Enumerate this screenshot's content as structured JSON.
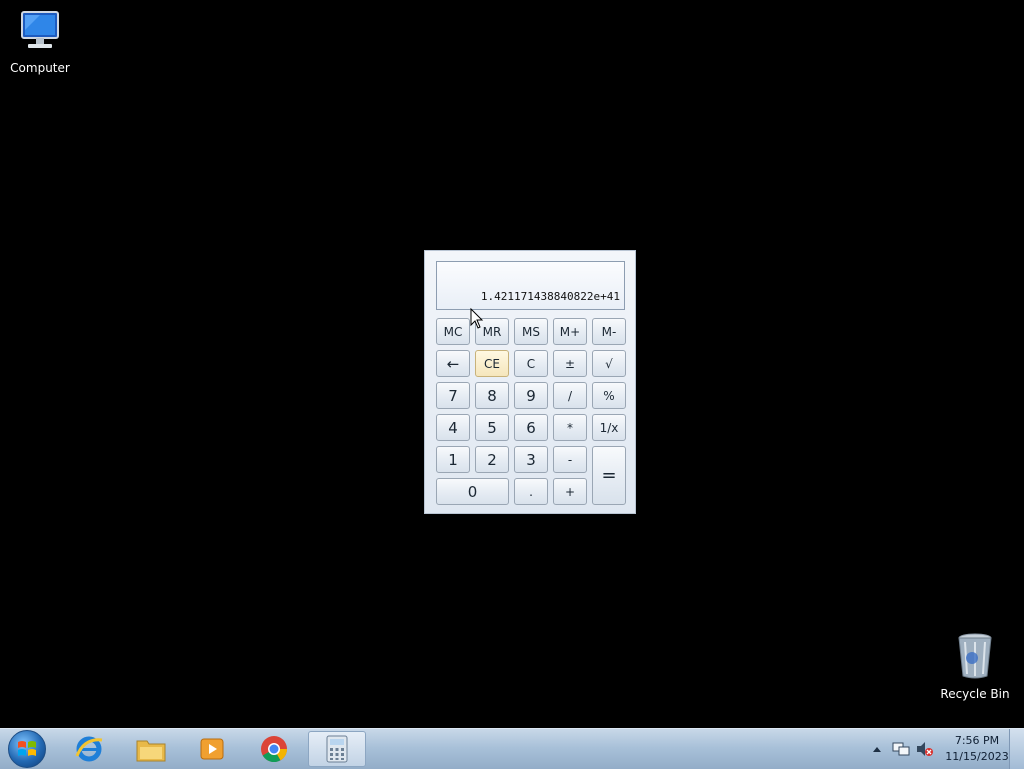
{
  "desktop": {
    "icons": [
      {
        "label": "Computer",
        "icon": "computer-icon"
      },
      {
        "label": "Recycle Bin",
        "icon": "recycle-bin-icon"
      }
    ]
  },
  "calculator": {
    "display": "1.421171438840822e+41",
    "memory_row": [
      "MC",
      "MR",
      "MS",
      "M+",
      "M-"
    ],
    "row2": [
      "←",
      "CE",
      "C",
      "±",
      "√"
    ],
    "row3": [
      "7",
      "8",
      "9",
      "/",
      "%"
    ],
    "row4": [
      "4",
      "5",
      "6",
      "*",
      "1/x"
    ],
    "row5": [
      "1",
      "2",
      "3",
      "-",
      "="
    ],
    "row6": [
      "0",
      ".",
      "+"
    ]
  },
  "taskbar": {
    "apps": [
      {
        "name": "internet-explorer-icon"
      },
      {
        "name": "file-explorer-icon"
      },
      {
        "name": "media-player-icon"
      },
      {
        "name": "chrome-icon"
      },
      {
        "name": "calculator-icon"
      }
    ],
    "clock_time": "7:56 PM",
    "clock_date": "11/15/2023"
  },
  "colors": {
    "desktop_bg": "#000000",
    "taskbar": "#a9c1d9",
    "ce_button": "#f5e6bc"
  }
}
